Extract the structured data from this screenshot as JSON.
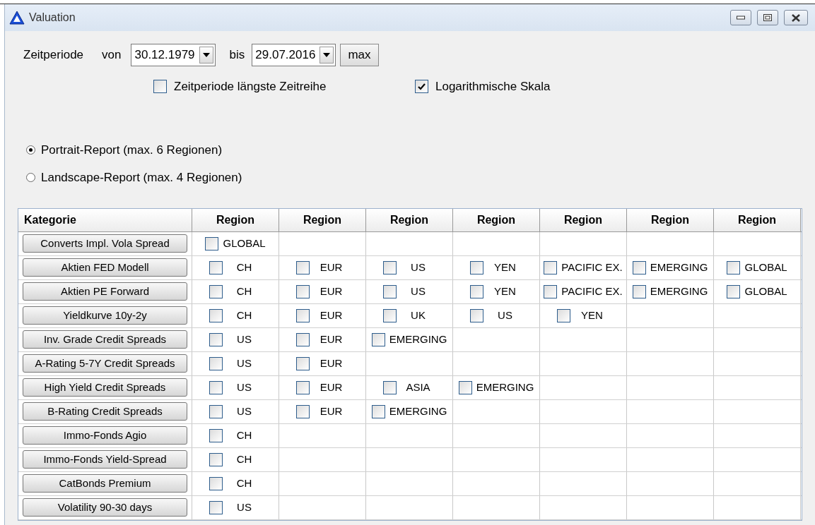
{
  "window": {
    "title": "Valuation"
  },
  "period": {
    "label": "Zeitperiode",
    "from_label": "von",
    "from_value": "30.12.1979",
    "to_label": "bis",
    "to_value": "29.07.2016",
    "max_button": "max"
  },
  "options": [
    {
      "label": "Zeitperiode längste Zeitreihe",
      "checked": false
    },
    {
      "label": "Logarithmische Skala",
      "checked": true
    }
  ],
  "report": [
    {
      "label": "Portrait-Report (max. 6 Regionen)",
      "selected": true
    },
    {
      "label": "Landscape-Report (max. 4 Regionen)",
      "selected": false
    }
  ],
  "table": {
    "columns": [
      "Kategorie",
      "Region",
      "Region",
      "Region",
      "Region",
      "Region",
      "Region",
      "Region"
    ],
    "rows": [
      {
        "category": "Converts Impl. Vola Spread",
        "regions": [
          {
            "label": "GLOBAL",
            "checked": false
          }
        ]
      },
      {
        "category": "Aktien FED Modell",
        "regions": [
          {
            "label": "CH",
            "checked": false
          },
          {
            "label": "EUR",
            "checked": false
          },
          {
            "label": "US",
            "checked": false
          },
          {
            "label": "YEN",
            "checked": false
          },
          {
            "label": "PACIFIC EX.",
            "checked": false
          },
          {
            "label": "EMERGING",
            "checked": false
          },
          {
            "label": "GLOBAL",
            "checked": false
          }
        ]
      },
      {
        "category": "Aktien PE Forward",
        "regions": [
          {
            "label": "CH",
            "checked": false
          },
          {
            "label": "EUR",
            "checked": false
          },
          {
            "label": "US",
            "checked": false
          },
          {
            "label": "YEN",
            "checked": false
          },
          {
            "label": "PACIFIC EX.",
            "checked": false
          },
          {
            "label": "EMERGING",
            "checked": false
          },
          {
            "label": "GLOBAL",
            "checked": false
          }
        ]
      },
      {
        "category": "Yieldkurve 10y-2y",
        "regions": [
          {
            "label": "CH",
            "checked": false
          },
          {
            "label": "EUR",
            "checked": false
          },
          {
            "label": "UK",
            "checked": false
          },
          {
            "label": "US",
            "checked": false
          },
          {
            "label": "YEN",
            "checked": false
          }
        ]
      },
      {
        "category": "Inv. Grade Credit Spreads",
        "regions": [
          {
            "label": "US",
            "checked": false
          },
          {
            "label": "EUR",
            "checked": false
          },
          {
            "label": "EMERGING",
            "checked": false
          }
        ]
      },
      {
        "category": "A-Rating 5-7Y Credit Spreads",
        "regions": [
          {
            "label": "US",
            "checked": false
          },
          {
            "label": "EUR",
            "checked": false
          }
        ]
      },
      {
        "category": "High Yield Credit Spreads",
        "regions": [
          {
            "label": "US",
            "checked": false
          },
          {
            "label": "EUR",
            "checked": false
          },
          {
            "label": "ASIA",
            "checked": false
          },
          {
            "label": "EMERGING",
            "checked": false
          }
        ]
      },
      {
        "category": "B-Rating Credit Spreads",
        "regions": [
          {
            "label": "US",
            "checked": false
          },
          {
            "label": "EUR",
            "checked": false
          },
          {
            "label": "EMERGING",
            "checked": false
          }
        ]
      },
      {
        "category": "Immo-Fonds Agio",
        "regions": [
          {
            "label": "CH",
            "checked": false
          }
        ]
      },
      {
        "category": "Immo-Fonds Yield-Spread",
        "regions": [
          {
            "label": "CH",
            "checked": false
          }
        ]
      },
      {
        "category": "CatBonds Premium",
        "regions": [
          {
            "label": "CH",
            "checked": false
          }
        ]
      },
      {
        "category": "Volatility 90-30 days",
        "regions": [
          {
            "label": "US",
            "checked": false
          }
        ]
      }
    ]
  }
}
